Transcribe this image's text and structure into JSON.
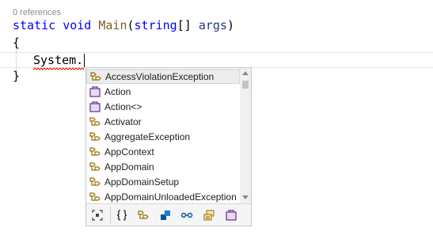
{
  "editor": {
    "codelens": "0 references",
    "line1": {
      "kw1": "static",
      "kw2": "void",
      "method": "Main",
      "paren_open": "(",
      "kw3": "string",
      "brackets": "[]",
      "param": "args",
      "paren_close": ")"
    },
    "open_brace": "{",
    "current_text": "System.",
    "close_brace": "}"
  },
  "completion": {
    "items": [
      {
        "label": "AccessViolationException",
        "icon": "class-icon",
        "selected": true
      },
      {
        "label": "Action",
        "icon": "delegate-icon"
      },
      {
        "label": "Action<>",
        "icon": "delegate-icon"
      },
      {
        "label": "Activator",
        "icon": "class-icon"
      },
      {
        "label": "AggregateException",
        "icon": "class-icon"
      },
      {
        "label": "AppContext",
        "icon": "class-icon"
      },
      {
        "label": "AppDomain",
        "icon": "class-icon"
      },
      {
        "label": "AppDomainSetup",
        "icon": "class-icon"
      },
      {
        "label": "AppDomainUnloadedException",
        "icon": "class-icon"
      }
    ],
    "filters": [
      "expander-filter-icon",
      "namespace-filter-icon",
      "class-filter-icon",
      "struct-filter-icon",
      "interface-filter-icon",
      "enum-filter-icon",
      "delegate-filter-icon"
    ]
  },
  "colors": {
    "keyword": "#0000ff",
    "type": "#2b91af",
    "class_icon": "#996f00",
    "delegate_icon": "#652d90",
    "struct_icon": "#00539c",
    "squiggle": "#e51400"
  }
}
